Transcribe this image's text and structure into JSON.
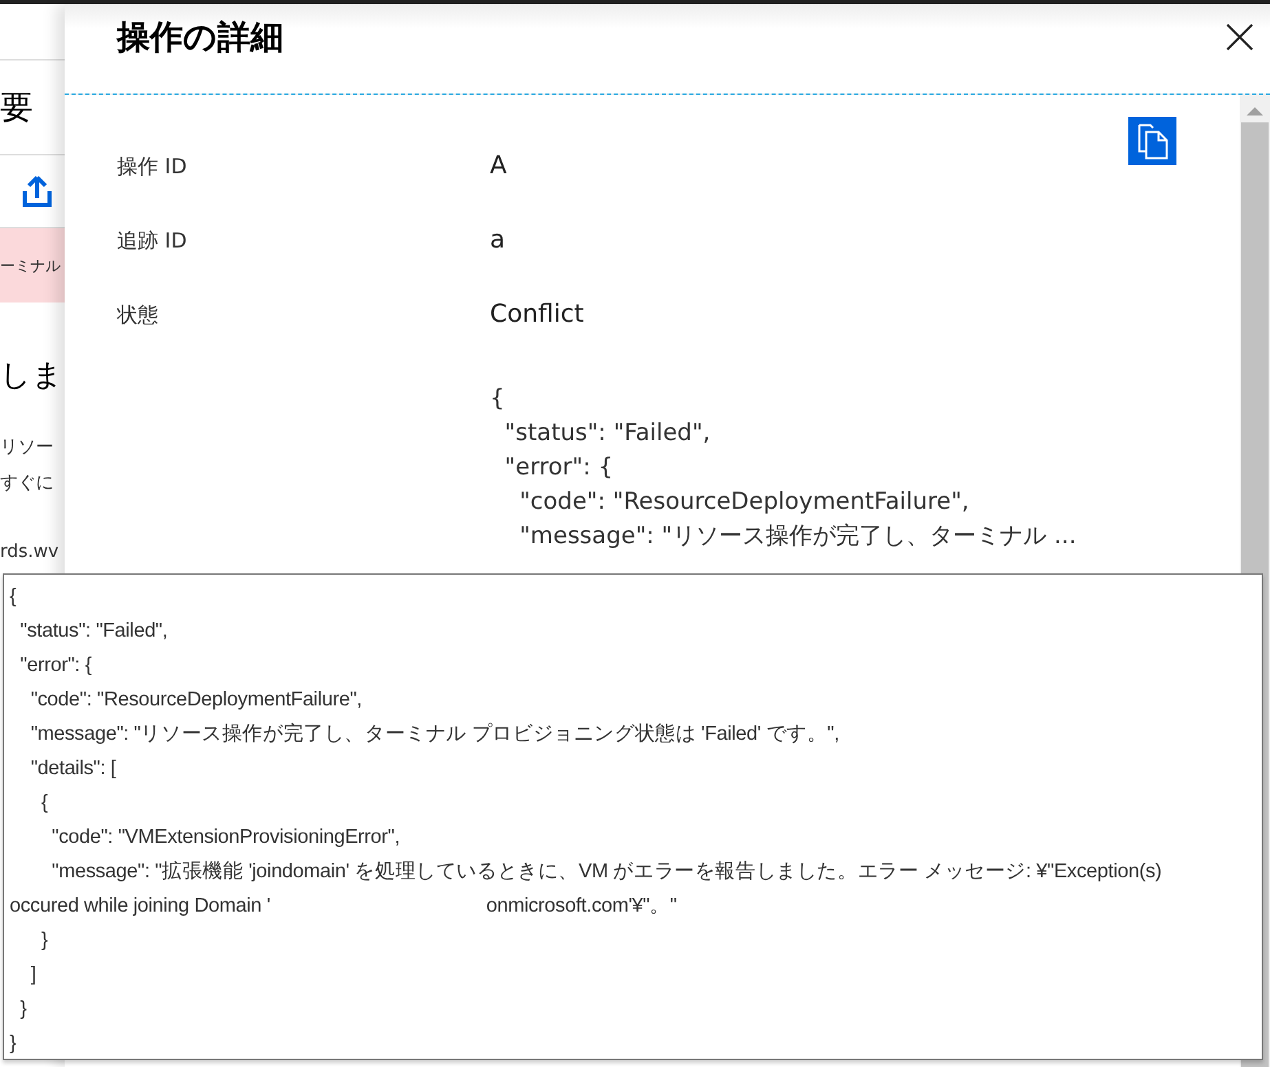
{
  "background_blade": {
    "heading": "要",
    "banner": "ーミナル",
    "large_text": "しま",
    "text_lines": [
      "リソー",
      "すぐに"
    ],
    "link_text": "rds.wv"
  },
  "panel": {
    "title": "操作の詳細",
    "fields": [
      {
        "label": "操作 ID",
        "value": "A"
      },
      {
        "label": "追跡 ID",
        "value": "a"
      },
      {
        "label": "状態",
        "value": "Conflict"
      }
    ],
    "json_lines": [
      "{",
      "  \"status\": \"Failed\",",
      "  \"error\": {",
      "    \"code\": \"ResourceDeploymentFailure\",",
      "    \"message\": \"リソース操作が完了し、ターミナル ..."
    ]
  },
  "tooltip": {
    "lines": [
      "{",
      "  \"status\": \"Failed\",",
      "  \"error\": {",
      "    \"code\": \"ResourceDeploymentFailure\",",
      "    \"message\": \"リソース操作が完了し、ターミナル プロビジョニング状態は 'Failed' です。\",",
      "    \"details\": [",
      "      {",
      "        \"code\": \"VMExtensionProvisioningError\",",
      "        \"message\": \"拡張機能 'joindomain' を処理しているときに、VM がエラーを報告しました。エラー メッセージ: ¥\"Exception(s)",
      "occured while joining Domain '                                         onmicrosoft.com'¥\"。\"",
      "      }",
      "    ]",
      "  }",
      "}"
    ]
  }
}
